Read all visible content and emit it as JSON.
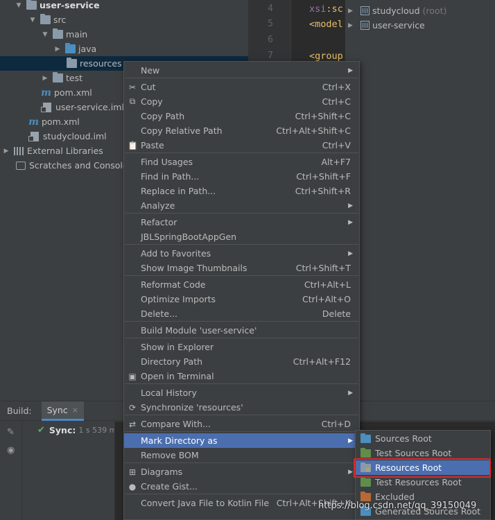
{
  "tree": {
    "rows": [
      {
        "label": "user-service"
      },
      {
        "label": "src"
      },
      {
        "label": "main"
      },
      {
        "label": "java"
      },
      {
        "label": "resources"
      },
      {
        "label": "test"
      },
      {
        "label": "pom.xml"
      },
      {
        "label": "user-service.iml"
      },
      {
        "label": "pom.xml"
      },
      {
        "label": "studycloud.iml"
      },
      {
        "label": "External Libraries"
      },
      {
        "label": "Scratches and Consoles"
      }
    ]
  },
  "editor": {
    "lines": [
      {
        "num": "4",
        "ns": "xsi",
        "rest": ":sc"
      },
      {
        "num": "5",
        "text": "<model"
      },
      {
        "num": "6",
        "text": ""
      },
      {
        "num": "7",
        "text": "<group"
      }
    ]
  },
  "maven": {
    "projects": [
      {
        "label": "studycloud",
        "suffix": "(root)"
      },
      {
        "label": "user-service",
        "suffix": ""
      }
    ]
  },
  "build": {
    "label": "Build:",
    "tab": "Sync",
    "tab_close": "×",
    "sync_label": "Sync:",
    "sync_time": "1 s 539 ms"
  },
  "menu": {
    "items": [
      {
        "label": "New",
        "shortcut": "",
        "submenu": true,
        "icon": ""
      },
      {
        "label": "Cut",
        "shortcut": "Ctrl+X",
        "icon": "cut-icon"
      },
      {
        "label": "Copy",
        "shortcut": "Ctrl+C",
        "icon": "copy-icon"
      },
      {
        "label": "Copy Path",
        "shortcut": "Ctrl+Shift+C",
        "icon": ""
      },
      {
        "label": "Copy Relative Path",
        "shortcut": "Ctrl+Alt+Shift+C",
        "icon": ""
      },
      {
        "label": "Paste",
        "shortcut": "Ctrl+V",
        "icon": "paste-icon"
      },
      {
        "label": "Find Usages",
        "shortcut": "Alt+F7",
        "icon": ""
      },
      {
        "label": "Find in Path...",
        "shortcut": "Ctrl+Shift+F",
        "icon": ""
      },
      {
        "label": "Replace in Path...",
        "shortcut": "Ctrl+Shift+R",
        "icon": ""
      },
      {
        "label": "Analyze",
        "shortcut": "",
        "submenu": true,
        "icon": ""
      },
      {
        "label": "Refactor",
        "shortcut": "",
        "submenu": true,
        "icon": ""
      },
      {
        "label": "JBLSpringBootAppGen",
        "shortcut": "",
        "icon": ""
      },
      {
        "label": "Add to Favorites",
        "shortcut": "",
        "submenu": true,
        "icon": ""
      },
      {
        "label": "Show Image Thumbnails",
        "shortcut": "Ctrl+Shift+T",
        "icon": ""
      },
      {
        "label": "Reformat Code",
        "shortcut": "Ctrl+Alt+L",
        "icon": ""
      },
      {
        "label": "Optimize Imports",
        "shortcut": "Ctrl+Alt+O",
        "icon": ""
      },
      {
        "label": "Delete...",
        "shortcut": "Delete",
        "icon": ""
      },
      {
        "label": "Build Module 'user-service'",
        "shortcut": "",
        "icon": ""
      },
      {
        "label": "Show in Explorer",
        "shortcut": "",
        "icon": ""
      },
      {
        "label": "Directory Path",
        "shortcut": "Ctrl+Alt+F12",
        "icon": ""
      },
      {
        "label": "Open in Terminal",
        "shortcut": "",
        "icon": "terminal-icon"
      },
      {
        "label": "Local History",
        "shortcut": "",
        "submenu": true,
        "icon": ""
      },
      {
        "label": "Synchronize 'resources'",
        "shortcut": "",
        "icon": "sync-icon"
      },
      {
        "label": "Compare With...",
        "shortcut": "Ctrl+D",
        "icon": "compare-icon"
      },
      {
        "label": "Mark Directory as",
        "shortcut": "",
        "submenu": true,
        "icon": ""
      },
      {
        "label": "Remove BOM",
        "shortcut": "",
        "icon": ""
      },
      {
        "label": "Diagrams",
        "shortcut": "",
        "submenu": true,
        "icon": "diagrams-icon"
      },
      {
        "label": "Create Gist...",
        "shortcut": "",
        "icon": "github-icon"
      },
      {
        "label": "Convert Java File to Kotlin File",
        "shortcut": "Ctrl+Alt+Shift+K",
        "icon": ""
      }
    ]
  },
  "submenu": {
    "items": [
      {
        "label": "Sources Root"
      },
      {
        "label": "Test Sources Root"
      },
      {
        "label": "Resources Root"
      },
      {
        "label": "Test Resources Root"
      },
      {
        "label": "Excluded"
      },
      {
        "label": "Generated Sources Root"
      }
    ]
  },
  "watermark": "https://blog.csdn.net/qq_39150049",
  "colors": {
    "menu_highlight": "#4b6eaf",
    "selection_box": "#e0272a",
    "sync_check": "#5fb05f"
  }
}
